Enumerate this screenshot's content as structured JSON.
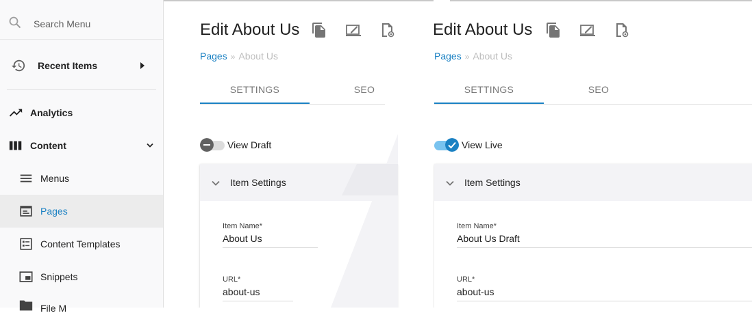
{
  "sidebar": {
    "search_placeholder": "Search Menu",
    "recent_items": "Recent Items",
    "analytics": "Analytics",
    "content": "Content",
    "menus": "Menus",
    "pages": "Pages",
    "content_templates": "Content Templates",
    "snippets": "Snippets",
    "file_manager_partial": "File M"
  },
  "left": {
    "title": "Edit About Us",
    "breadcrumb_link": "Pages",
    "breadcrumb_sep": "»",
    "breadcrumb_current": "About Us",
    "tab_settings": "SETTINGS",
    "tab_seo": "SEO",
    "toggle_label": "View Draft",
    "section_title": "Item Settings",
    "item_name_label": "Item Name*",
    "item_name_value": "About Us",
    "url_label": "URL*",
    "url_value": "about-us"
  },
  "right": {
    "title": "Edit About Us",
    "breadcrumb_link": "Pages",
    "breadcrumb_sep": "»",
    "breadcrumb_current": "About Us",
    "tab_settings": "SETTINGS",
    "tab_seo": "SEO",
    "toggle_label": "View Live",
    "section_title": "Item Settings",
    "item_name_label": "Item Name*",
    "item_name_value": "About Us Draft",
    "url_label": "URL*",
    "url_value": "about-us"
  },
  "colors": {
    "accent": "#1a81c3",
    "toggle_on": "#1a81c3",
    "toggle_on_track": "#79c3ef",
    "toggle_off_knob": "#616161",
    "toggle_off_track": "#dcdcdc"
  }
}
